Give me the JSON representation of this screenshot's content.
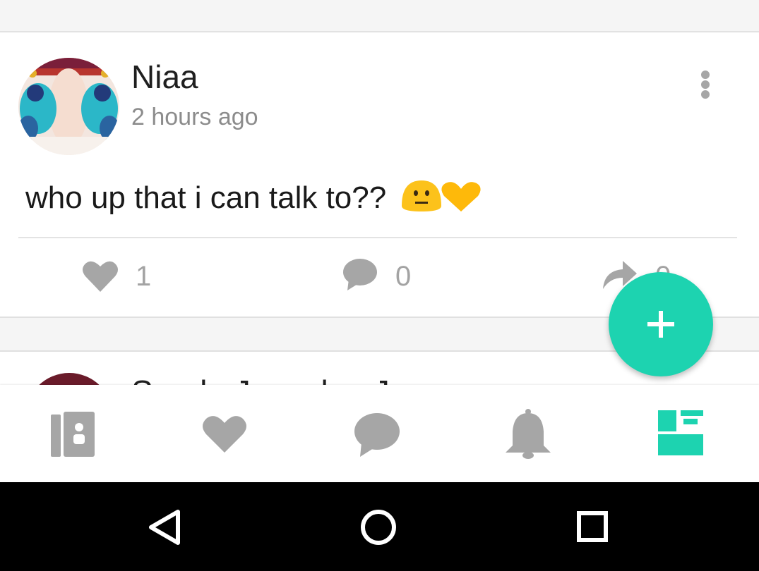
{
  "post": {
    "author": "Niaa",
    "time": "2 hours ago",
    "text": "who up that i can talk to??",
    "emojis": [
      "neutral-face-emoji",
      "yellow-heart-emoji"
    ],
    "likes": "1",
    "comments": "0",
    "shares": "0"
  },
  "next_post": {
    "author": "Sanda Jaeyelon Jr"
  },
  "fab": {
    "icon": "plus-icon"
  },
  "bottom_nav": {
    "items": [
      {
        "icon": "profile-cards-icon",
        "active": false
      },
      {
        "icon": "heart-icon",
        "active": false
      },
      {
        "icon": "chat-bubble-icon",
        "active": false
      },
      {
        "icon": "bell-icon",
        "active": false
      },
      {
        "icon": "feed-layout-icon",
        "active": true
      }
    ]
  },
  "system_nav": {
    "items": [
      "back-icon",
      "home-icon",
      "recents-icon"
    ]
  },
  "colors": {
    "accent": "#1dd3b0",
    "icon_gray": "#a6a6a6",
    "text_dark": "#1f1f1f",
    "text_muted": "#8c8c8c"
  }
}
